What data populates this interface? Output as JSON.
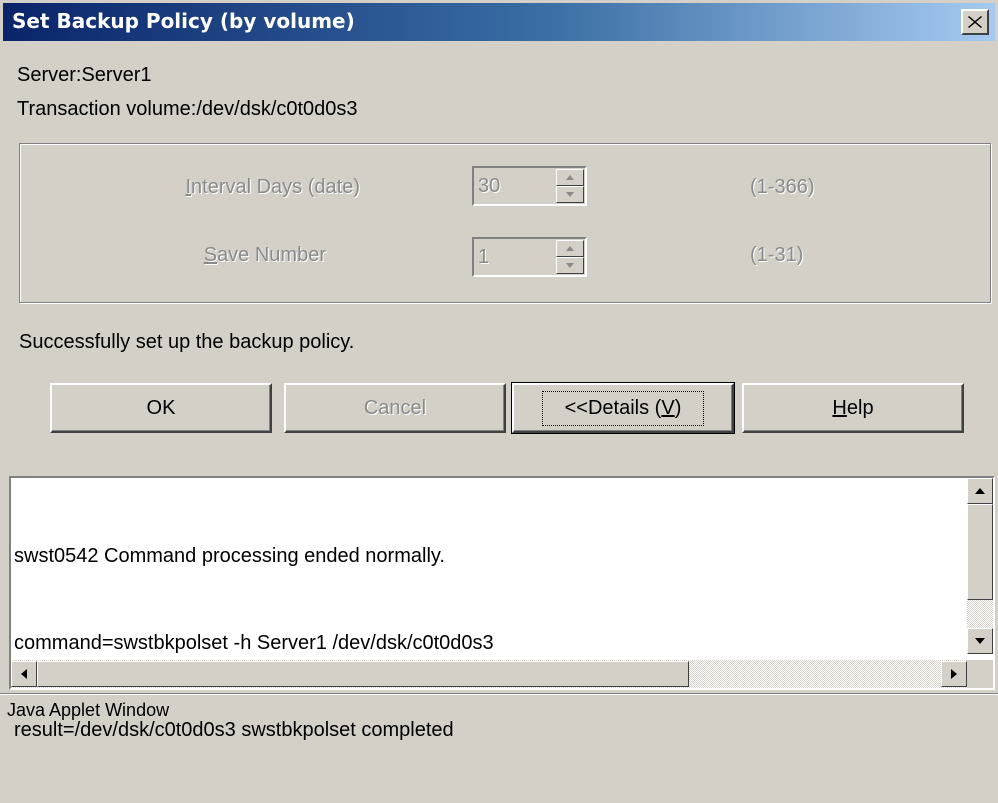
{
  "window": {
    "title": "Set Backup Policy (by volume)",
    "close_glyph": "×"
  },
  "info": {
    "server": "Server:Server1",
    "volume": "Transaction volume:/dev/dsk/c0t0d0s3"
  },
  "fields": {
    "interval": {
      "label_mnemonic": "I",
      "label_rest": "nterval Days (date)",
      "value": "30",
      "range": "(1-366)"
    },
    "save_number": {
      "label_mnemonic": "S",
      "label_rest": "ave Number",
      "value": "1",
      "range": "(1-31)"
    }
  },
  "status_message": "Successfully set up the backup policy.",
  "buttons": {
    "ok": "OK",
    "cancel": "Cancel",
    "details_prefix": "<<Details (",
    "details_mnemonic": "V",
    "details_suffix": ")",
    "help_mnemonic": "H",
    "help_rest": "elp"
  },
  "log": {
    "lines": [
      "swst0542 Command processing ended normally.",
      "command=swstbkpolset -h Server1 /dev/dsk/c0t0d0s3",
      "result=/dev/dsk/c0t0d0s3 swstbkpolset completed"
    ]
  },
  "footer": "Java Applet Window",
  "colors": {
    "titlebar_start": "#0a246a",
    "titlebar_end": "#a6caf0",
    "face": "#d4d0c8",
    "disabled_text": "#8a8a8a"
  }
}
